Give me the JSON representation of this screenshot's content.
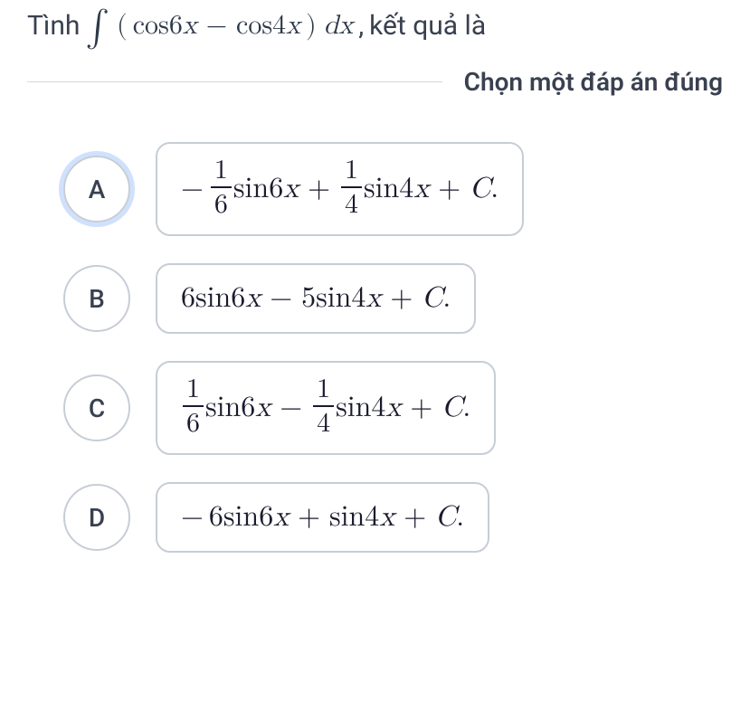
{
  "question": {
    "prefix": "Tình",
    "integral": "∫",
    "open": "(",
    "term1a": "cos6",
    "term1b": "x",
    "minus": "−",
    "term2a": "cos4",
    "term2b": "x",
    "close": ")",
    "diff_d": "d",
    "diff_x": "x",
    "comma": ",",
    "suffix": "kết quả là"
  },
  "instruction": "Chọn một đáp án đúng",
  "options": {
    "A": {
      "letter": "A",
      "selected": true,
      "parts": {
        "lead_neg": "−",
        "f1n": "1",
        "f1d": "6",
        "s1a": "sin6",
        "s1b": "x",
        "op1": "+",
        "f2n": "1",
        "f2d": "4",
        "s2a": "sin4",
        "s2b": "x",
        "op2": "+",
        "C": "C",
        "dot": "."
      }
    },
    "B": {
      "letter": "B",
      "selected": false,
      "parts": {
        "s1a": "6sin6",
        "s1b": "x",
        "op1": "−",
        "s2a": "5sin4",
        "s2b": "x",
        "op2": "+",
        "C": "C",
        "dot": "."
      }
    },
    "C": {
      "letter": "C",
      "selected": false,
      "parts": {
        "f1n": "1",
        "f1d": "6",
        "s1a": "sin6",
        "s1b": "x",
        "op1": "−",
        "f2n": "1",
        "f2d": "4",
        "s2a": "sin4",
        "s2b": "x",
        "op2": "+",
        "C": "C",
        "dot": "."
      }
    },
    "D": {
      "letter": "D",
      "selected": false,
      "parts": {
        "lead_neg": "−",
        "s1a": "6sin6",
        "s1b": "x",
        "op1": "+",
        "s2a": "sin4",
        "s2b": "x",
        "op2": "+",
        "C": "C",
        "dot": "."
      }
    }
  }
}
